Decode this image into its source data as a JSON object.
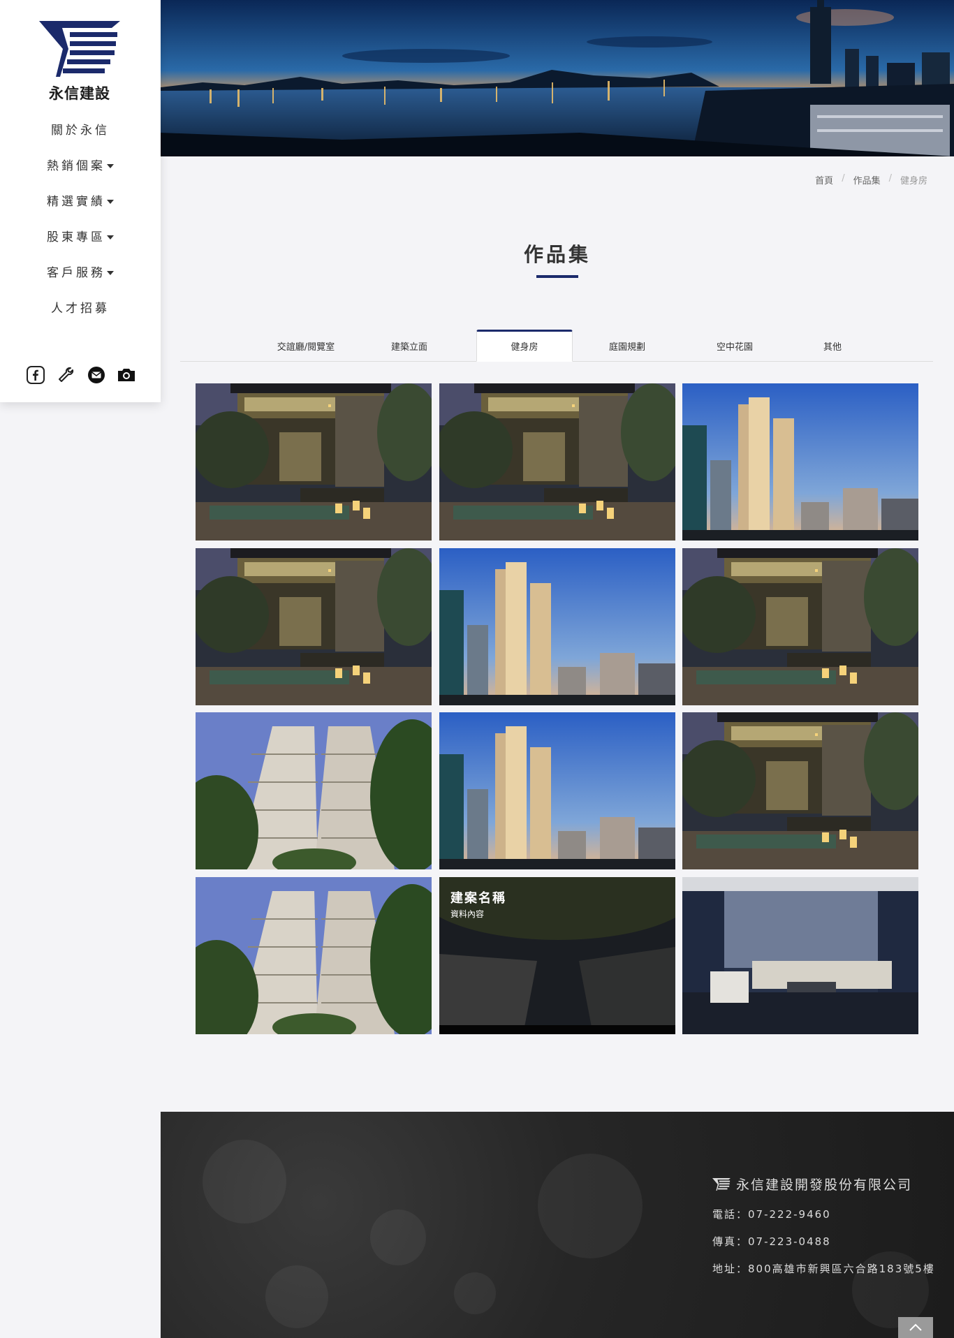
{
  "brand": {
    "logo_text": "永信建設",
    "color_primary": "#1b2a6b"
  },
  "nav": {
    "items": [
      {
        "label": "關於永信",
        "dropdown": false
      },
      {
        "label": "熱銷個案",
        "dropdown": true
      },
      {
        "label": "精選實績",
        "dropdown": true
      },
      {
        "label": "股東專區",
        "dropdown": true
      },
      {
        "label": "客戶服務",
        "dropdown": true
      },
      {
        "label": "人才招募",
        "dropdown": false
      }
    ],
    "socials": [
      "facebook-icon",
      "wrench-icon",
      "mail-icon",
      "camera-icon"
    ]
  },
  "breadcrumb": {
    "items": [
      "首頁",
      "作品集",
      "健身房"
    ]
  },
  "page": {
    "title": "作品集"
  },
  "tabs": {
    "items": [
      "交誼廳/閱覽室",
      "建築立面",
      "健身房",
      "庭園規劃",
      "空中花園",
      "其他"
    ],
    "active_index": 2
  },
  "gallery": {
    "tiles": [
      {
        "scene": "villa-night"
      },
      {
        "scene": "villa-night"
      },
      {
        "scene": "towers-dusk"
      },
      {
        "scene": "villa-night"
      },
      {
        "scene": "towers-dusk"
      },
      {
        "scene": "villa-night"
      },
      {
        "scene": "highrise-day"
      },
      {
        "scene": "towers-dusk"
      },
      {
        "scene": "villa-night"
      },
      {
        "scene": "highrise-day"
      },
      {
        "scene": "looking-up-dark",
        "title": "建案名稱",
        "subtitle": "資料內容"
      },
      {
        "scene": "living-room"
      }
    ]
  },
  "footer": {
    "company": "永信建設開發股份有限公司",
    "phone": "電話：07-222-9460",
    "fax": "傳真：07-223-0488",
    "address": "地址：800高雄市新興區六合路183號5樓"
  }
}
